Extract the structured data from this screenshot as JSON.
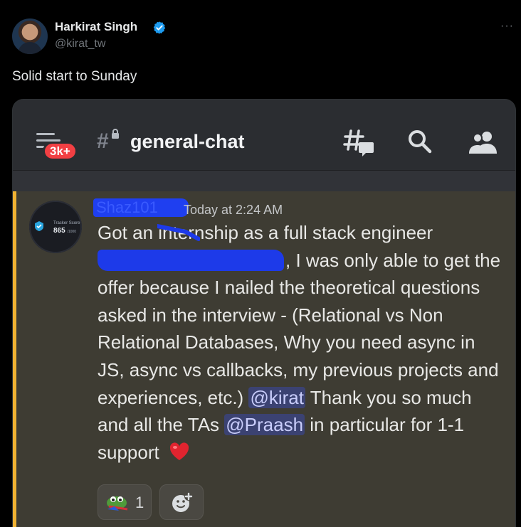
{
  "tweet": {
    "author_name": "Harkirat Singh",
    "author_handle": "@kirat_tw",
    "text": "Solid start to Sunday",
    "more_label": "···"
  },
  "discord": {
    "badge_count": "3k+",
    "channel_name": "general-chat",
    "message": {
      "username": "Shaz101",
      "timestamp": "Today at 2:24 AM",
      "avatar_tracker_label": "Tracker Score",
      "avatar_tracker_score": "865",
      "avatar_tracker_max": "/1000",
      "line_1": "Got an internship as a full stack engineer",
      "line_2_after_redaction": ", I was only able to get the offer because I nailed the theoretical questions asked in the interview - (Relational vs Non Relational Databases, Why you need async in JS, async vs callbacks, my previous projects and experiences, etc.)",
      "mention_1": "@kirat",
      "text_between_mentions": " Thank you so much and all the TAs ",
      "mention_2": "@Praash",
      "text_end": " in particular for 1-1 support",
      "reaction_count": "1"
    }
  },
  "colors": {
    "accent_highlight": "#f0b232",
    "badge_red": "#f23f43",
    "verified_blue": "#1d9bf0",
    "mention_bg": "#3b4272"
  },
  "icons": [
    "verified-icon",
    "more-icon",
    "menu-icon",
    "hash-lock-icon",
    "threads-icon",
    "search-icon",
    "members-icon",
    "heart-icon",
    "frog-icon",
    "add-reaction-icon"
  ]
}
